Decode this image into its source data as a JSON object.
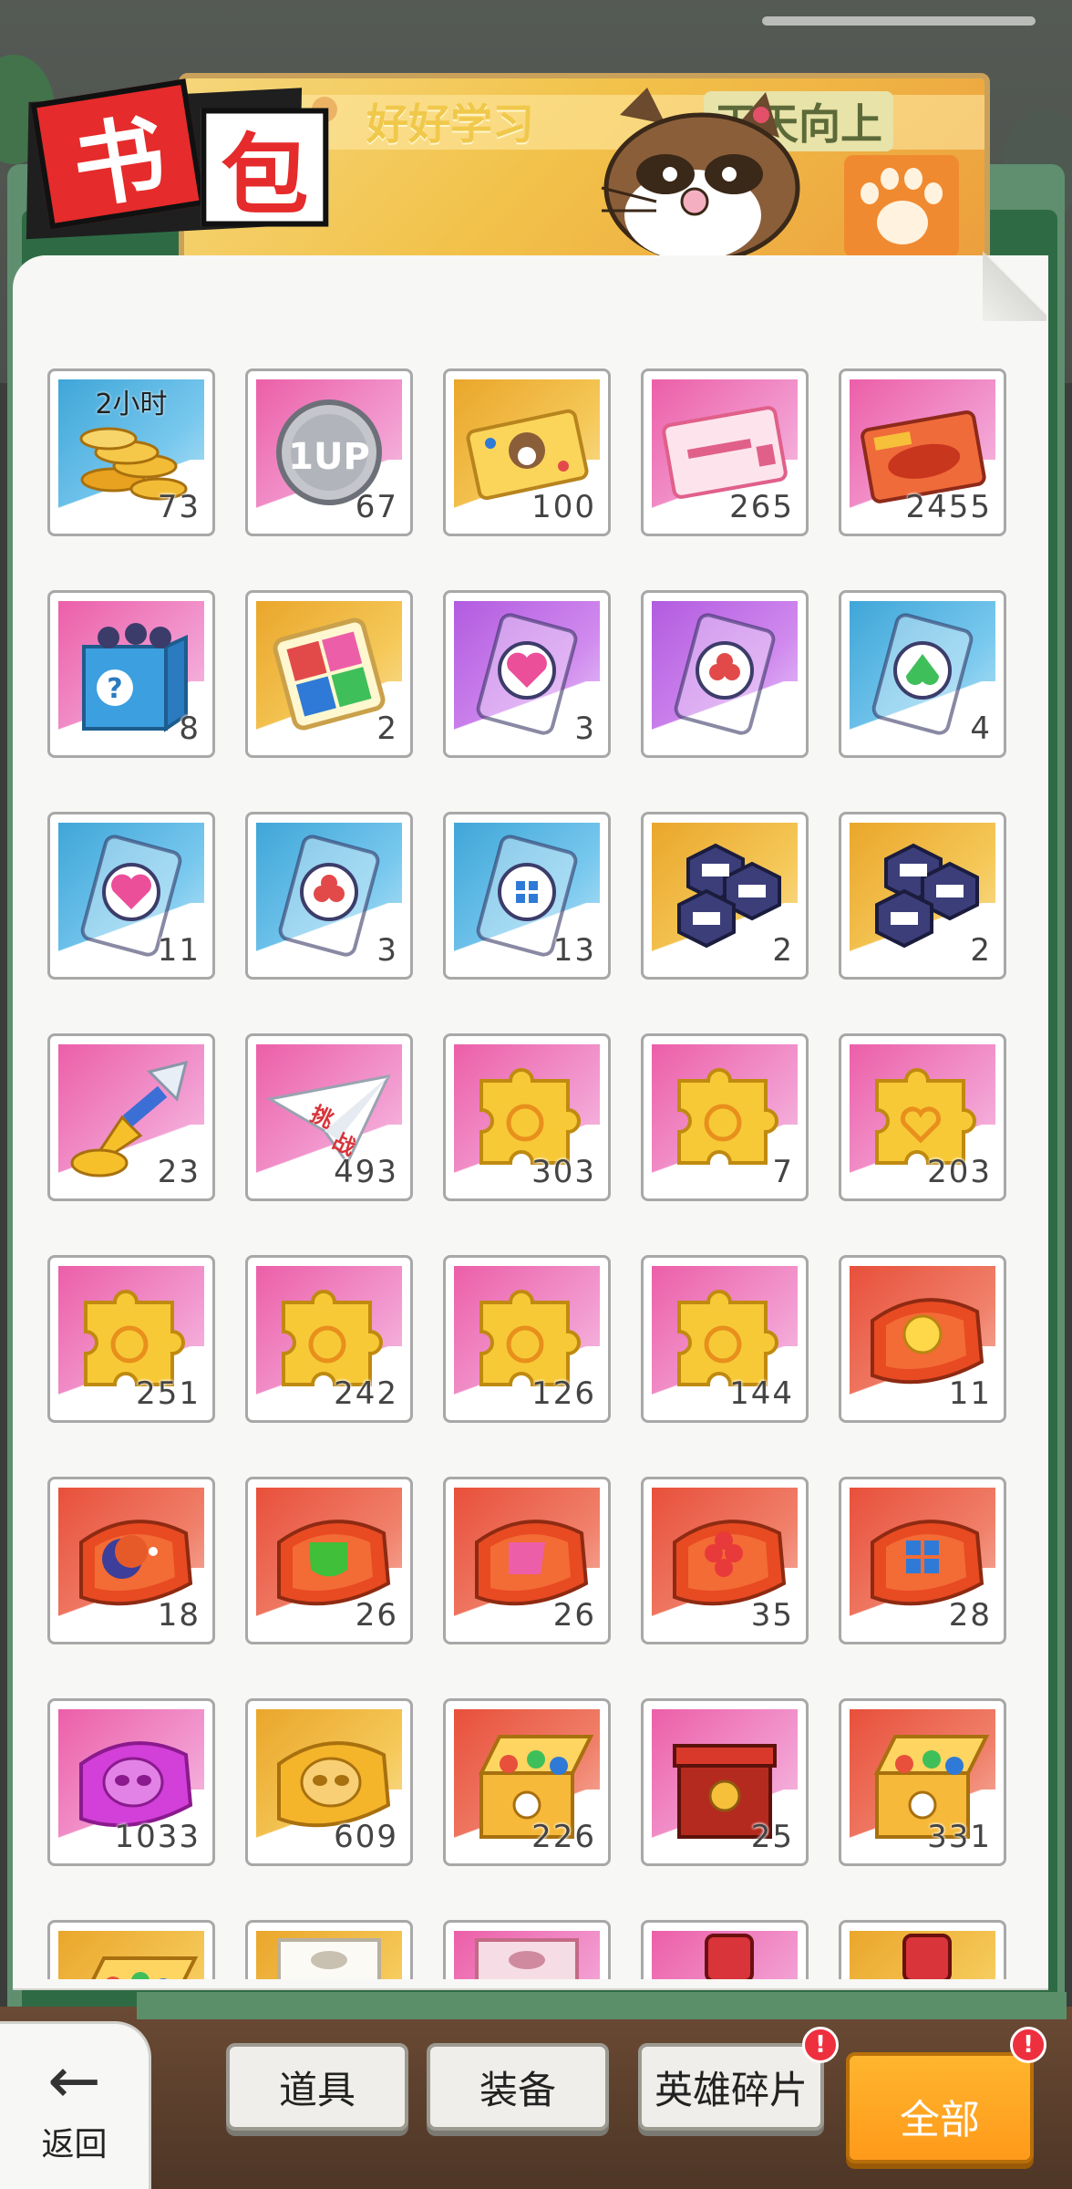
{
  "header": {
    "title_char_1": "书",
    "title_char_2": "包",
    "slogan_left": "好好学习",
    "slogan_right": "天天向上"
  },
  "items": [
    {
      "count": "73",
      "tag": "2小时",
      "theme": "blue",
      "icon": "gold-coins-icon"
    },
    {
      "count": "67",
      "theme": "pink",
      "icon": "1up-coin-icon"
    },
    {
      "count": "100",
      "theme": "gold",
      "icon": "raccoon-card-icon"
    },
    {
      "count": "265",
      "theme": "pink",
      "icon": "ticket-icon"
    },
    {
      "count": "2455",
      "theme": "pink",
      "icon": "food-card-icon"
    },
    {
      "count": "8",
      "theme": "pink",
      "icon": "mystery-box-icon"
    },
    {
      "count": "2",
      "theme": "gold",
      "icon": "four-suit-card-icon"
    },
    {
      "count": "3",
      "theme": "purple",
      "icon": "heart-card-icon"
    },
    {
      "count": "",
      "theme": "purple",
      "icon": "club-card-icon"
    },
    {
      "count": "4",
      "theme": "blue",
      "icon": "spade-card-icon"
    },
    {
      "count": "11",
      "theme": "blue",
      "icon": "heart-card-icon"
    },
    {
      "count": "3",
      "theme": "blue",
      "icon": "club-card-icon"
    },
    {
      "count": "13",
      "theme": "blue",
      "icon": "diamond-card-icon"
    },
    {
      "count": "2",
      "theme": "gold",
      "icon": "hex-boots-icon"
    },
    {
      "count": "2",
      "theme": "gold",
      "icon": "hex-head-icon"
    },
    {
      "count": "23",
      "theme": "pink",
      "icon": "trumpet-icon"
    },
    {
      "count": "493",
      "theme": "pink",
      "icon": "paper-plane-icon",
      "plane_text": "挑战"
    },
    {
      "count": "303",
      "theme": "pink",
      "icon": "puzzle-piece-icon"
    },
    {
      "count": "7",
      "theme": "pink",
      "icon": "puzzle-piece-icon"
    },
    {
      "count": "203",
      "theme": "pink",
      "icon": "puzzle-heart-icon"
    },
    {
      "count": "251",
      "theme": "pink",
      "icon": "puzzle-piece-icon"
    },
    {
      "count": "242",
      "theme": "pink",
      "icon": "puzzle-piece-icon"
    },
    {
      "count": "126",
      "theme": "pink",
      "icon": "puzzle-piece-icon"
    },
    {
      "count": "144",
      "theme": "pink",
      "icon": "puzzle-piece-icon"
    },
    {
      "count": "11",
      "theme": "red",
      "icon": "sun-emblem-icon"
    },
    {
      "count": "18",
      "theme": "red",
      "icon": "moon-emblem-icon"
    },
    {
      "count": "26",
      "theme": "red",
      "icon": "green-emblem-icon"
    },
    {
      "count": "26",
      "theme": "red",
      "icon": "pink-emblem-icon"
    },
    {
      "count": "35",
      "theme": "red",
      "icon": "club-emblem-icon"
    },
    {
      "count": "28",
      "theme": "red",
      "icon": "blue-emblem-icon"
    },
    {
      "count": "1033",
      "theme": "pink",
      "icon": "purple-raccoon-emblem-icon"
    },
    {
      "count": "609",
      "theme": "gold",
      "icon": "gold-raccoon-emblem-icon"
    },
    {
      "count": "226",
      "theme": "red",
      "icon": "treasure-box-icon"
    },
    {
      "count": "25",
      "theme": "pink",
      "icon": "red-chest-icon"
    },
    {
      "count": "331",
      "theme": "red",
      "icon": "treasure-box-icon"
    },
    {
      "count": "",
      "theme": "gold",
      "icon": "treasure-box-icon"
    },
    {
      "count": "",
      "theme": "gold",
      "icon": "white-box-icon"
    },
    {
      "count": "",
      "theme": "pink",
      "icon": "pink-box-icon"
    },
    {
      "count": "",
      "theme": "pink",
      "icon": "can-icon"
    },
    {
      "count": "",
      "theme": "gold",
      "icon": "can-icon"
    }
  ],
  "nav": {
    "back_label": "返回",
    "back_arrow": "←",
    "tabs": [
      {
        "label": "道具"
      },
      {
        "label": "装备"
      },
      {
        "label": "英雄碎片",
        "alert": "!"
      },
      {
        "label": "全部",
        "alert": "!",
        "active": true
      }
    ]
  },
  "colors": {
    "accent": "#ff9a1a",
    "alert": "#ee2f3e",
    "title_red": "#e52b2b"
  }
}
